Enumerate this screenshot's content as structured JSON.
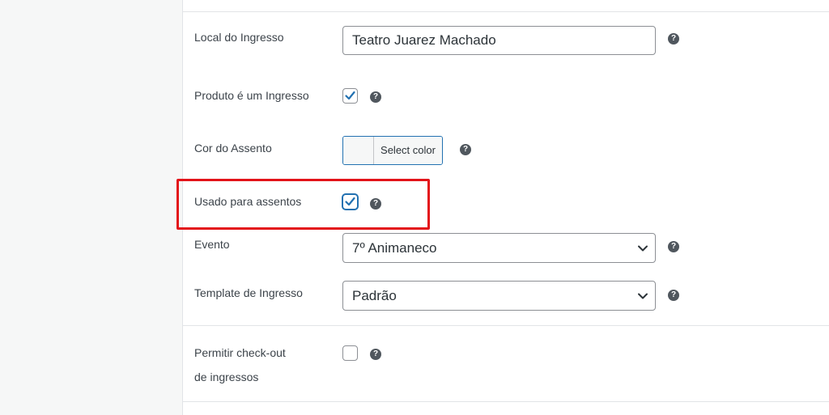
{
  "fields": {
    "local": {
      "label": "Local do Ingresso",
      "value": "Teatro Juarez Machado"
    },
    "produto": {
      "label": "Produto é um Ingresso",
      "checked": true
    },
    "cor": {
      "label": "Cor do Assento",
      "button_label": "Select color"
    },
    "usado": {
      "label": "Usado para assentos",
      "checked": true
    },
    "evento": {
      "label": "Evento",
      "selected": "7º Animaneco"
    },
    "template": {
      "label": "Template de Ingresso",
      "selected": "Padrão"
    },
    "checkout": {
      "label_line1": "Permitir check-out",
      "label_line2": "de ingressos",
      "checked": false
    }
  },
  "help_glyph": "?",
  "colors": {
    "accent": "#2271b1",
    "highlight_border": "#e3141a",
    "help_icon_bg": "#50575e"
  }
}
